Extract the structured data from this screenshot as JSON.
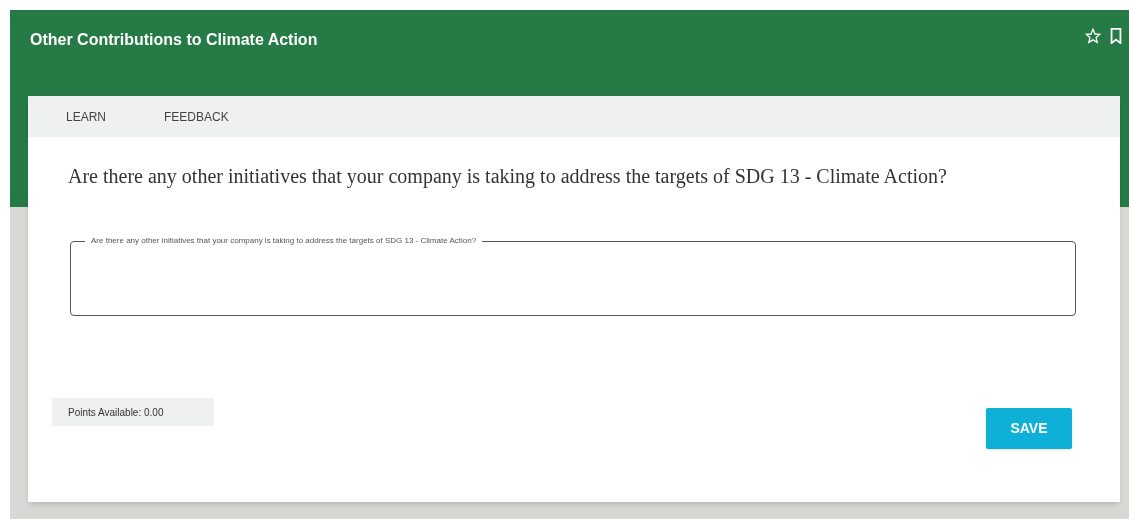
{
  "header": {
    "title": "Other Contributions to Climate Action"
  },
  "tabs": [
    {
      "label": "LEARN"
    },
    {
      "label": "FEEDBACK"
    }
  ],
  "question": "Are there any other initiatives that your company is taking to address the targets of SDG 13 - Climate Action?",
  "answer_field": {
    "label": "Are there any other initiatives that your company is taking to address the targets of SDG 13 - Climate Action?"
  },
  "points": "Points Available: 0.00",
  "save_button": "SAVE"
}
